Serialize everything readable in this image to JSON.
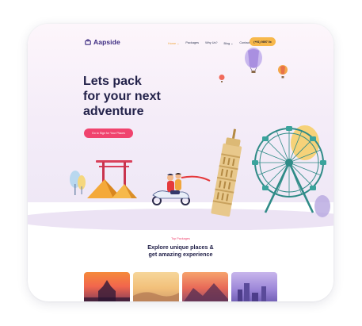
{
  "header": {
    "logo_text": "Aapside",
    "logo_icon": "suitcase-icon",
    "nav": [
      {
        "label": "Home ⌄",
        "active": true
      },
      {
        "label": "Packages",
        "active": false
      },
      {
        "label": "Why Us?",
        "active": false
      },
      {
        "label": "Blog ⌄",
        "active": false
      },
      {
        "label": "Contact",
        "active": false
      }
    ],
    "cta_label": "(+91) 9897 0x"
  },
  "hero": {
    "headline_line1": "Lets pack",
    "headline_line2": "for your next",
    "headline_line3": "adventure",
    "button_label": "Go to Sign for Your Places"
  },
  "section": {
    "tag": "Top Packages",
    "title_line1": "Explore unique places &",
    "title_line2": "get amazing experience"
  },
  "colors": {
    "accent_pink": "#f0436e",
    "accent_yellow": "#f7b84b",
    "heading": "#23224a",
    "brand": "#3b2a80"
  }
}
